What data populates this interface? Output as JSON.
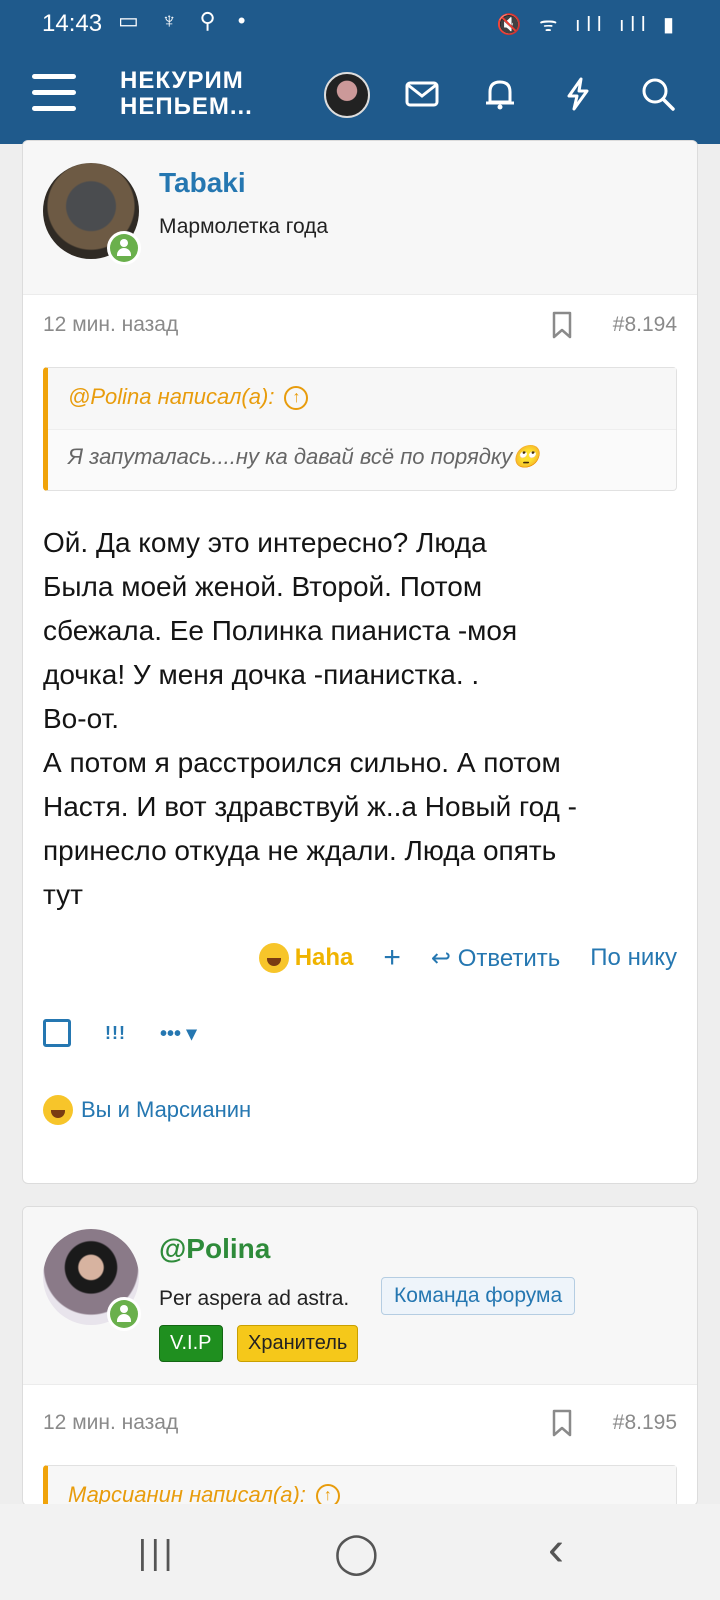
{
  "status_bar": {
    "time": "14:43",
    "left_icons": "▭ ♆ ⚲ •",
    "right_icons": "🔇 ᯤ ıll ıll ▮"
  },
  "header": {
    "logo_line1": "НЕКУРИМ",
    "logo_line2": "НЕПЬЕМ...",
    "colors": {
      "bar": "#1f5a8c"
    }
  },
  "posts": [
    {
      "username": "Tabaki",
      "user_title": "Мармолетка года",
      "time": "12 мин. назад",
      "number": "#8.194",
      "quote_author": "@Polina написал(а):",
      "quote_text": "Я запуталась....ну ка давай всё по порядку🙄",
      "message": [
        "Ой. Да кому это интересно? Люда",
        "Была моей женой. Второй. Потом",
        "сбежала. Ее Полинка пианиста -моя",
        "дочка! У меня дочка -пианистка. .",
        "Во-от.",
        "А потом я расстроился сильно. А потом",
        "Настя. И вот здравствуй ж..а Новый год -",
        "принесло откуда не ждали. Люда опять",
        "тут"
      ],
      "reaction_label": "Haha",
      "add_label": "+",
      "reply_label": "Ответить",
      "by_nick_label": "По нику",
      "report_label": "!!!",
      "more_label": "••• ▾",
      "reactions_summary": "Вы и Марсианин"
    },
    {
      "username": "@Polina",
      "user_title": "Per aspera ad astra.",
      "banner": "Команда форума",
      "badges": [
        "V.I.P",
        "Хранитель"
      ],
      "time": "12 мин. назад",
      "number": "#8.195",
      "quote_author": "Марсианин написал(а):"
    }
  ],
  "bottom_nav": {
    "recent": "|||",
    "home": "◯",
    "back": "‹"
  }
}
